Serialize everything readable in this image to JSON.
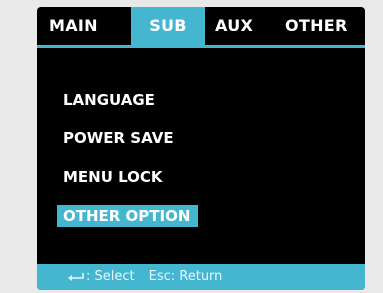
{
  "tabs": [
    {
      "label": "MAIN"
    },
    {
      "label": "SUB",
      "active": true
    },
    {
      "label": "AUX"
    },
    {
      "label": "OTHER"
    }
  ],
  "menu": {
    "items": [
      {
        "label": "LANGUAGE"
      },
      {
        "label": "POWER SAVE"
      },
      {
        "label": "MENU LOCK"
      },
      {
        "label": "OTHER OPTION",
        "selected": true
      }
    ]
  },
  "footer": {
    "select_icon": "enter-icon",
    "select_text": ": Select",
    "return_text": "Esc: Return"
  },
  "colors": {
    "accent": "#45b6d0",
    "background": "#000000",
    "text": "#ffffff"
  }
}
